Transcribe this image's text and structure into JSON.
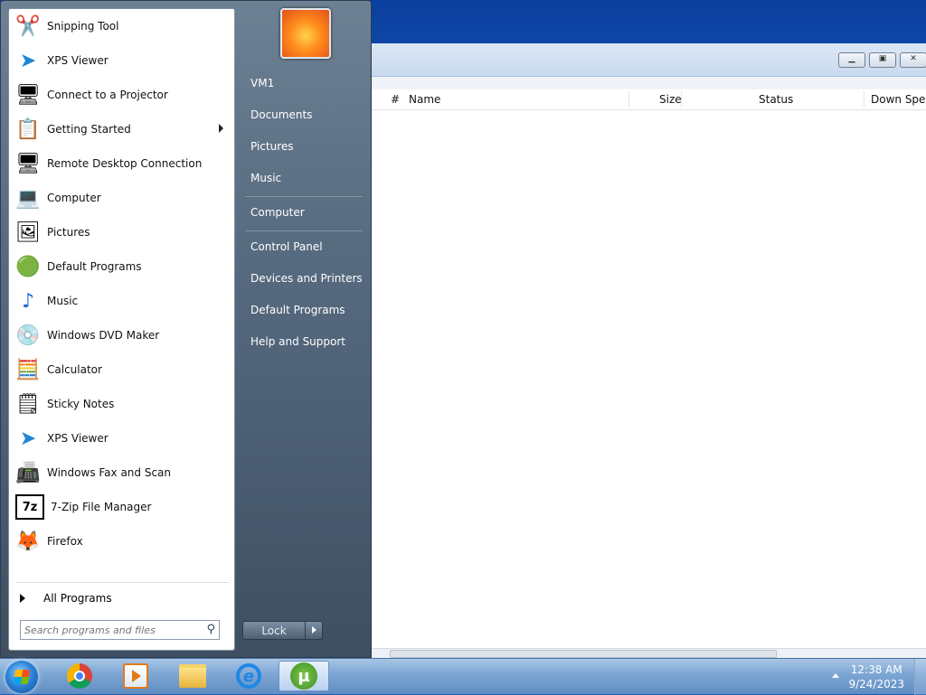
{
  "start_menu": {
    "programs": [
      {
        "label": "Snipping Tool",
        "icon": "scissors-icon"
      },
      {
        "label": "XPS Viewer",
        "icon": "paper-plane-icon"
      },
      {
        "label": "Connect to a Projector",
        "icon": "projector-icon"
      },
      {
        "label": "Getting Started",
        "icon": "getting-started-icon",
        "submenu": true
      },
      {
        "label": "Remote Desktop Connection",
        "icon": "remote-desktop-icon"
      },
      {
        "label": "Computer",
        "icon": "computer-icon"
      },
      {
        "label": "Pictures",
        "icon": "pictures-icon"
      },
      {
        "label": "Default Programs",
        "icon": "default-programs-icon"
      },
      {
        "label": "Music",
        "icon": "music-note-icon"
      },
      {
        "label": "Windows DVD Maker",
        "icon": "dvd-icon"
      },
      {
        "label": "Calculator",
        "icon": "calculator-icon"
      },
      {
        "label": "Sticky Notes",
        "icon": "sticky-notes-icon"
      },
      {
        "label": "XPS Viewer",
        "icon": "paper-plane-icon"
      },
      {
        "label": "Windows Fax and Scan",
        "icon": "fax-icon"
      },
      {
        "label": "7-Zip File Manager",
        "icon": "7zip-icon"
      },
      {
        "label": "Firefox",
        "icon": "firefox-icon"
      }
    ],
    "all_programs": "All Programs",
    "search_placeholder": "Search programs and files",
    "right_items": [
      "VM1",
      "Documents",
      "Pictures",
      "Music",
      "Computer",
      "Control Panel",
      "Devices and Printers",
      "Default Programs",
      "Help and Support"
    ],
    "lock_label": "Lock"
  },
  "torrent_window": {
    "columns": [
      "#",
      "Name",
      "Size",
      "Status",
      "Down Speed"
    ]
  },
  "taskbar": {
    "apps": [
      "chrome-icon",
      "media-player-icon",
      "file-explorer-icon",
      "internet-explorer-icon",
      "utorrent-icon"
    ],
    "time": "12:38 AM",
    "date": "9/24/2023"
  }
}
